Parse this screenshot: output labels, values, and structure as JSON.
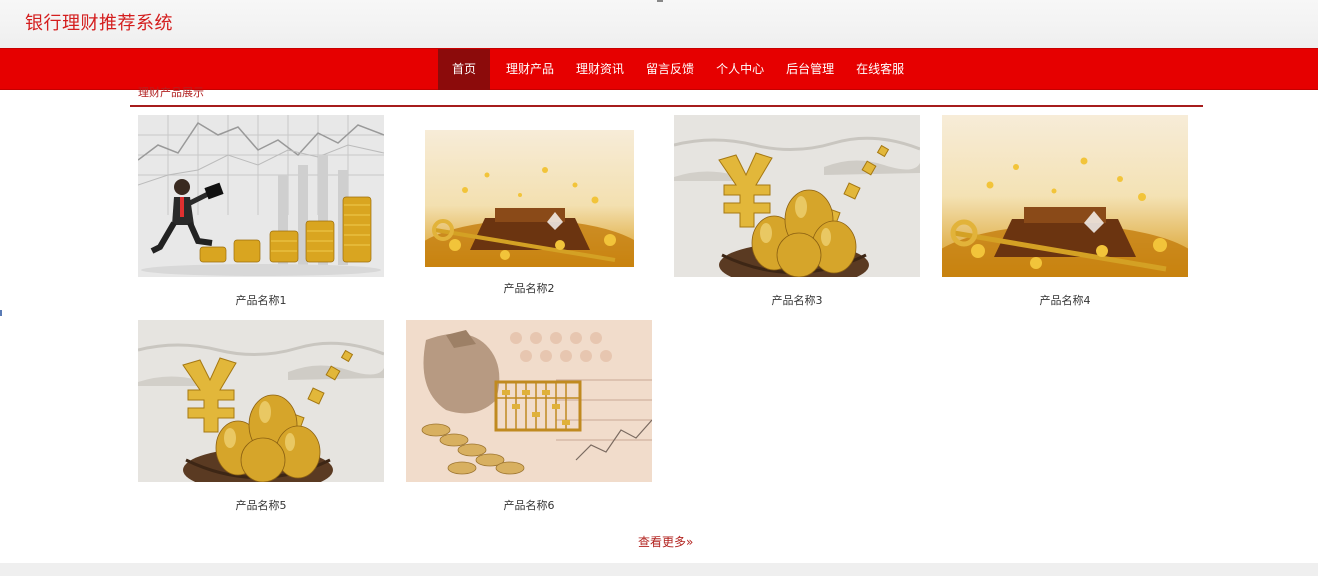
{
  "header": {
    "title": "银行理财推荐系统"
  },
  "nav": {
    "items": [
      {
        "label": "首页",
        "active": true
      },
      {
        "label": "理财产品"
      },
      {
        "label": "理财资讯"
      },
      {
        "label": "留言反馈"
      },
      {
        "label": "个人中心"
      },
      {
        "label": "后台管理"
      },
      {
        "label": "在线客服"
      }
    ]
  },
  "section": {
    "title": "理财产品展示"
  },
  "products": [
    {
      "name": "产品名称1",
      "image": "businessman-coin-stacks"
    },
    {
      "name": "产品名称2",
      "image": "golden-key-treasure"
    },
    {
      "name": "产品名称3",
      "image": "golden-eggs-nest"
    },
    {
      "name": "产品名称4",
      "image": "golden-key-treasure"
    },
    {
      "name": "产品名称5",
      "image": "golden-eggs-nest"
    },
    {
      "name": "产品名称6",
      "image": "money-bag-abacus"
    }
  ],
  "more": {
    "label": "查看更多"
  },
  "colors": {
    "brand_red": "#e60000",
    "nav_active": "#8c0b0b",
    "title_red": "#d41e1e"
  }
}
